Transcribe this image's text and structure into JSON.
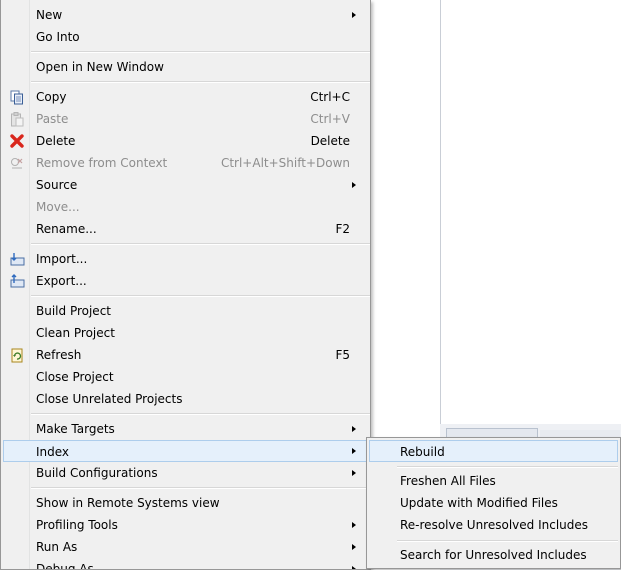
{
  "context_menu": {
    "items": [
      {
        "label": "New",
        "has_submenu": true
      },
      {
        "label": "Go Into"
      },
      {
        "label": "Open in New Window"
      },
      {
        "label": "Copy",
        "accel": "Ctrl+C",
        "icon": "copy-icon"
      },
      {
        "label": "Paste",
        "accel": "Ctrl+V",
        "icon": "paste-icon",
        "disabled": true
      },
      {
        "label": "Delete",
        "accel": "Delete",
        "icon": "delete-icon"
      },
      {
        "label": "Remove from Context",
        "accel": "Ctrl+Alt+Shift+Down",
        "icon": "remove-context-icon",
        "disabled": true
      },
      {
        "label": "Source",
        "has_submenu": true
      },
      {
        "label": "Move...",
        "disabled": true
      },
      {
        "label": "Rename...",
        "accel": "F2"
      },
      {
        "label": "Import...",
        "icon": "import-icon"
      },
      {
        "label": "Export...",
        "icon": "export-icon"
      },
      {
        "label": "Build Project"
      },
      {
        "label": "Clean Project"
      },
      {
        "label": "Refresh",
        "accel": "F5",
        "icon": "refresh-icon"
      },
      {
        "label": "Close Project"
      },
      {
        "label": "Close Unrelated Projects"
      },
      {
        "label": "Make Targets",
        "has_submenu": true
      },
      {
        "label": "Index",
        "has_submenu": true,
        "highlighted": true
      },
      {
        "label": "Build Configurations",
        "has_submenu": true
      },
      {
        "label": "Show in Remote Systems view"
      },
      {
        "label": "Profiling Tools",
        "has_submenu": true
      },
      {
        "label": "Run As",
        "has_submenu": true
      },
      {
        "label": "Debug As",
        "has_submenu": true
      }
    ]
  },
  "index_submenu": {
    "items": [
      {
        "label": "Rebuild",
        "highlighted": true
      },
      {
        "label": "Freshen All Files"
      },
      {
        "label": "Update with Modified Files"
      },
      {
        "label": "Re-resolve Unresolved Includes"
      },
      {
        "label": "Search for Unresolved Includes"
      }
    ]
  },
  "colors": {
    "menu_bg": "#f0f0f0",
    "highlight_bg": "#e5f0fb",
    "highlight_border": "#adcdec",
    "disabled_text": "#8d8d8d",
    "delete_red": "#d9261c"
  }
}
